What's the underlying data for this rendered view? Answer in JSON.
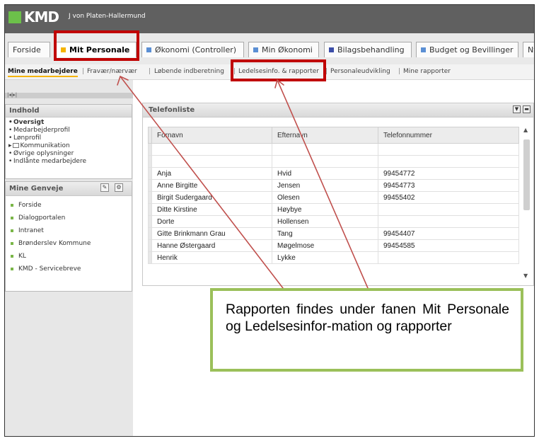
{
  "header": {
    "logo_text": "KMD",
    "username": "J von Platen-Hallermund"
  },
  "tabs": [
    {
      "label": "Forside",
      "color": ""
    },
    {
      "label": "Mit Personale",
      "color": "#f5b400"
    },
    {
      "label": "Økonomi (Controller)",
      "color": "#5b8fd4"
    },
    {
      "label": "Min Økonomi",
      "color": "#5b8fd4"
    },
    {
      "label": "Bilagsbehandling",
      "color": "#3c4ea8"
    },
    {
      "label": "Budget og Bevillinger",
      "color": "#5b8fd4"
    },
    {
      "label": "Nyl",
      "color": ""
    }
  ],
  "subnav": [
    "Mine medarbejdere",
    "Fravær/nærvær",
    "Løbende indberetning",
    "Ledelsesinfo. & rapporter",
    "Personaleudvikling",
    "Mine rapporter"
  ],
  "pager": "|◂|▸|",
  "content_panel": {
    "title": "Indhold",
    "items": [
      "Oversigt",
      "Medarbejderprofil",
      "Lønprofil",
      "Kommunikation",
      "Øvrige oplysninger",
      "Indlånte medarbejdere"
    ]
  },
  "shortcuts_panel": {
    "title": "Mine Genveje",
    "items": [
      "Forside",
      "Dialogportalen",
      "Intranet",
      "Brønderslev Kommune",
      "KL",
      "KMD - Servicebreve"
    ]
  },
  "phone_list": {
    "title": "Telefonliste",
    "columns": [
      "Fornavn",
      "Efternavn",
      "Telefonnummer"
    ],
    "rows": [
      [
        "",
        "",
        ""
      ],
      [
        "",
        "",
        ""
      ],
      [
        "Anja",
        "Hvid",
        "99454772"
      ],
      [
        "Anne Birgitte",
        "Jensen",
        "99454773"
      ],
      [
        "Birgit Sudergaard",
        "Olesen",
        "99455402"
      ],
      [
        "Ditte Kirstine",
        "Høybye",
        ""
      ],
      [
        "Dorte",
        "Hollensen",
        ""
      ],
      [
        "Gitte Brinkmann Grau",
        "Tang",
        "99454407"
      ],
      [
        "Hanne Østergaard",
        "Møgelmose",
        "99454585"
      ],
      [
        "Henrik",
        "Lykke",
        ""
      ]
    ]
  },
  "callout_text": "Rapporten findes under fanen Mit Personale og Ledelsesinfor-mation og rapporter",
  "colors": {
    "highlight_red": "#c00000",
    "callout_border": "#9bc05a",
    "logo_green": "#6cc04a"
  }
}
